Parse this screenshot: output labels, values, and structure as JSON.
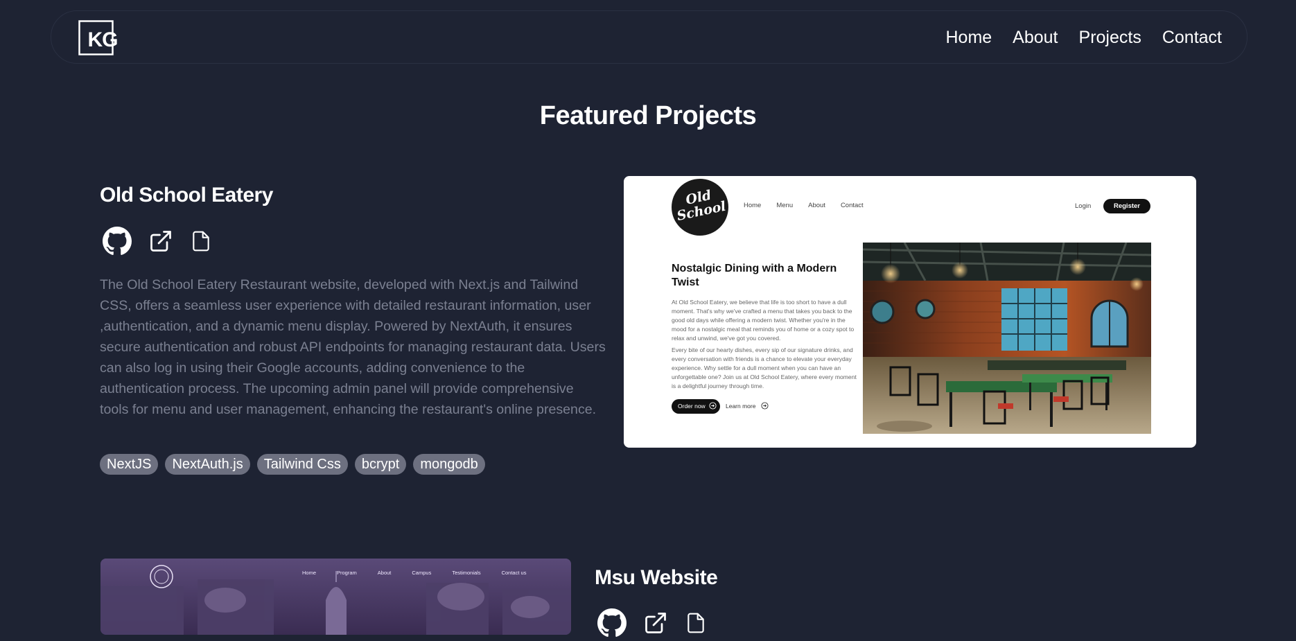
{
  "navbar": {
    "logo_text": "KG",
    "links": [
      "Home",
      "About",
      "Projects",
      "Contact"
    ]
  },
  "section_title": "Featured Projects",
  "project1": {
    "title": "Old School Eatery",
    "icons": [
      "github-icon",
      "external-link-icon",
      "document-icon"
    ],
    "description": "The Old School Eatery Restaurant website, developed with Next.js and Tailwind CSS, offers a seamless user experience with detailed restaurant information, user ,authentication, and a dynamic menu display. Powered by NextAuth, it ensures secure authentication and robust API endpoints for managing restaurant data. Users can also log in using their Google accounts, adding convenience to the authentication process. The upcoming admin panel will provide comprehensive tools for menu and user management, enhancing the restaurant's online presence.",
    "tags": [
      "NextJS",
      "NextAuth.js",
      "Tailwind Css",
      "bcrypt",
      "mongodb"
    ],
    "screenshot": {
      "logo_text": "Old School",
      "nav": [
        "Home",
        "Menu",
        "About",
        "Contact"
      ],
      "login": "Login",
      "register": "Register",
      "heading": "Nostalgic Dining with a Modern Twist",
      "para1": "At Old School Eatery, we believe that life is too short to have a dull moment. That's why we've crafted a menu that takes you back to the good old days while offering a modern twist. Whether you're in the mood for a nostalgic meal that reminds you of home or a cozy spot to relax and unwind, we've got you covered.",
      "para2": "Every bite of our hearty dishes, every sip of our signature drinks, and every conversation with friends is a chance to elevate your everyday experience. Why settle for a dull moment when you can have an unforgettable one? Join us at Old School Eatery, where every moment is a delightful journey through time.",
      "order_btn": "Order now",
      "learn_btn": "Learn more"
    }
  },
  "project2": {
    "title": "Msu Website",
    "icons": [
      "github-icon",
      "external-link-icon",
      "document-icon"
    ],
    "screenshot": {
      "nav": [
        "Home",
        "Program",
        "About",
        "Campus",
        "Testimonials",
        "Contact us"
      ]
    }
  },
  "colors": {
    "background": "#1e2333",
    "description_text": "#7b8091",
    "tag_background": "#6d7080"
  }
}
